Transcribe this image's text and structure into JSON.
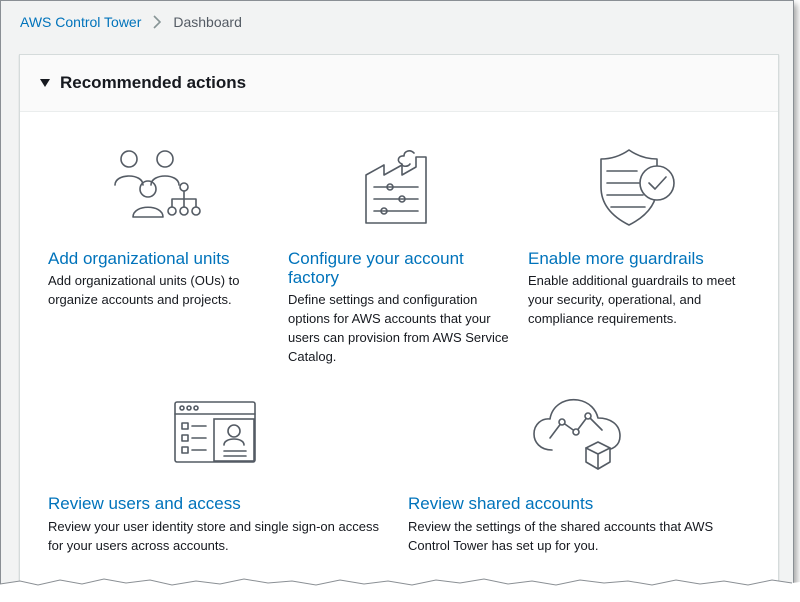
{
  "breadcrumb": {
    "root": "AWS Control Tower",
    "current": "Dashboard"
  },
  "panel": {
    "title": "Recommended actions",
    "cards": [
      {
        "title": "Add organizational units",
        "description": "Add organizational units (OUs) to organize accounts and projects."
      },
      {
        "title": "Configure your account factory",
        "description": "Define settings and configuration options for AWS accounts that your users can provision from AWS Service Catalog."
      },
      {
        "title": "Enable more guardrails",
        "description": "Enable additional guardrails to meet your security, operational, and compliance requirements."
      },
      {
        "title": "Review users and access",
        "description": "Review your user identity store and single sign-on access for your users across accounts."
      },
      {
        "title": "Review shared accounts",
        "description": "Review the settings of the shared accounts that AWS Control Tower has set up for you."
      }
    ]
  },
  "icons": {
    "org_units": "users-hierarchy-icon",
    "account_factory": "factory-icon",
    "guardrails": "shield-check-icon",
    "users_access": "user-profile-window-icon",
    "shared_accounts": "cloud-analytics-icon"
  },
  "colors": {
    "link": "#0073bb",
    "text": "#16191f",
    "icon_stroke": "#545b64",
    "background": "#f2f3f3"
  }
}
